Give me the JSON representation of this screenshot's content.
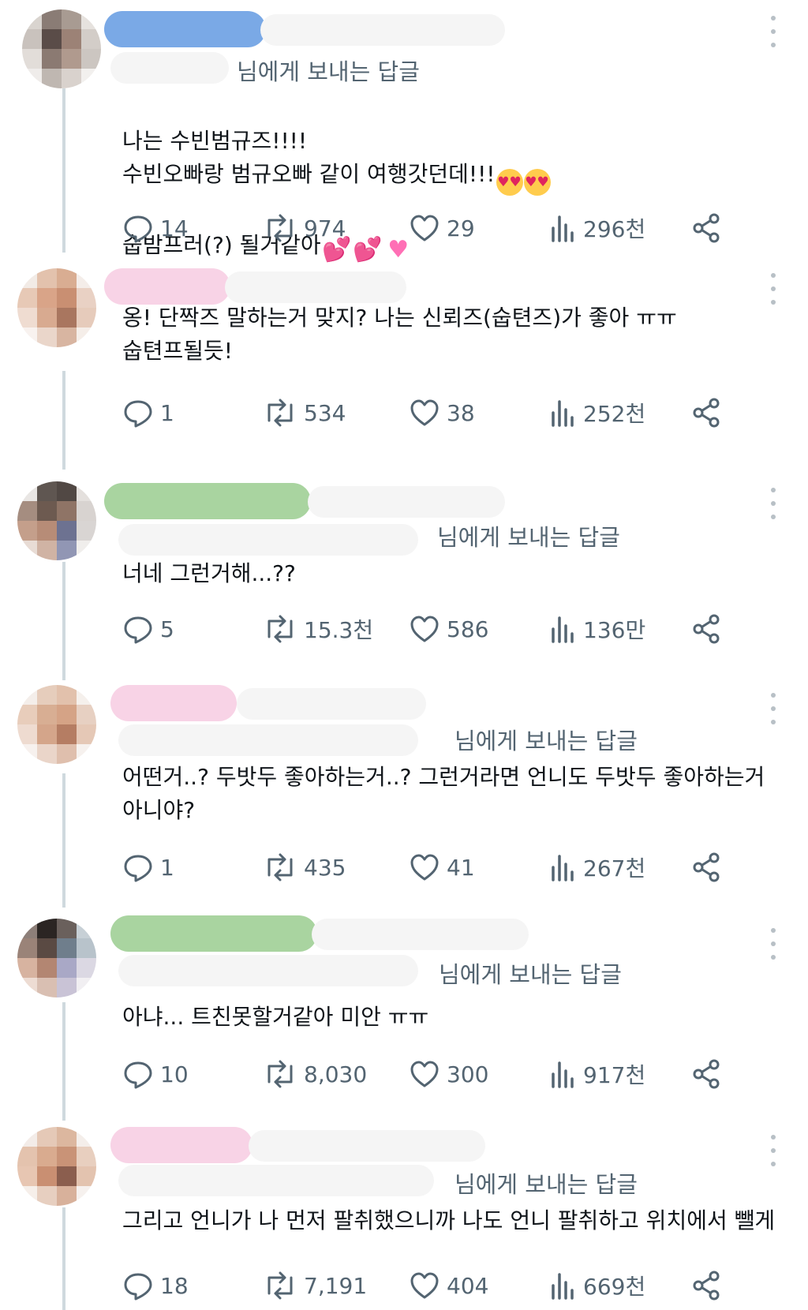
{
  "colors": {
    "accent_blue": "#7aa9e6",
    "pink": "#f8d3e6",
    "green": "#a9d4a0",
    "gray_text": "#536471"
  },
  "icons": {
    "reply": "speech-bubble-icon",
    "retweet": "retweet-icon",
    "like": "heart-icon",
    "views": "bar-chart-icon",
    "share": "share-icon",
    "more": "more-dots-icon"
  },
  "posts": [
    {
      "reply_to": "님에게 보내는 답글",
      "text": "나는 수빈범규즈!!!!\n수빈오빠랑 범규오빠 같이 여행갓던데!!!",
      "text_line3": "숩밤프러(?) 될거같아",
      "stats": {
        "replies": "14",
        "retweets": "974",
        "likes": "29",
        "views": "296천"
      }
    },
    {
      "reply_to": "",
      "text": "옹! 단짝즈 말하는거 맞지? 나는 신뢰즈(숩텬즈)가 좋아 ㅠㅠ\n숩텬프될듯!",
      "stats": {
        "replies": "1",
        "retweets": "534",
        "likes": "38",
        "views": "252천"
      }
    },
    {
      "reply_to": "님에게 보내는 답글",
      "text": "너네 그런거해...??",
      "stats": {
        "replies": "5",
        "retweets": "15.3천",
        "likes": "586",
        "views": "136만"
      }
    },
    {
      "reply_to": "님에게 보내는 답글",
      "text": "어떤거..? 두밧두 좋아하는거..? 그런거라면 언니도 두밧두 좋아하는거\n아니야?",
      "stats": {
        "replies": "1",
        "retweets": "435",
        "likes": "41",
        "views": "267천"
      }
    },
    {
      "reply_to": "님에게 보내는 답글",
      "text": "아냐... 트친못할거같아 미안 ㅠㅠ",
      "stats": {
        "replies": "10",
        "retweets": "8,030",
        "likes": "300",
        "views": "917천"
      }
    },
    {
      "reply_to": "님에게 보내는 답글",
      "text": "그리고 언니가 나 먼저 팔취했으니까 나도 언니 팔취하고 위치에서 뺄게",
      "stats": {
        "replies": "18",
        "retweets": "7,191",
        "likes": "404",
        "views": "669천"
      }
    }
  ]
}
